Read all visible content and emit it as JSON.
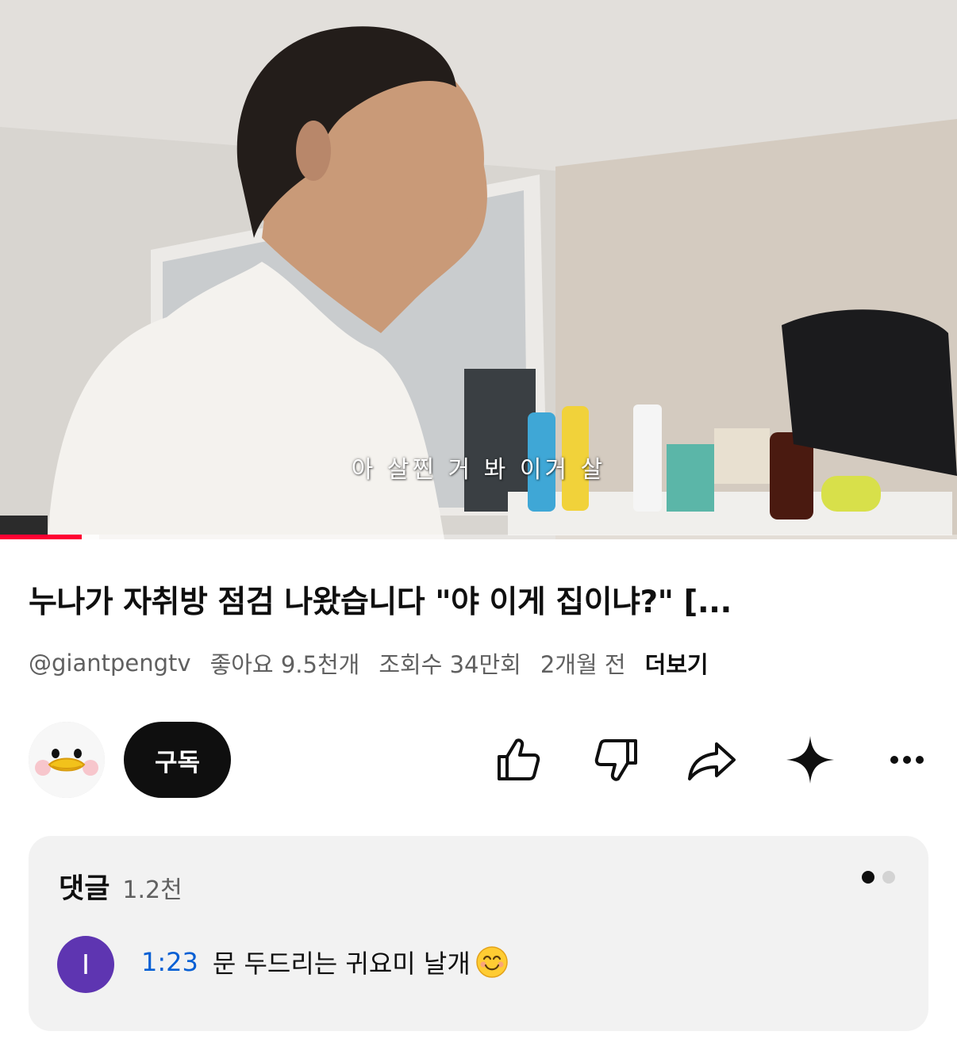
{
  "video": {
    "subtitle": "아 살찐 거 봐 이거 살",
    "progress": 0.085,
    "buffered": 0.104,
    "progress_color": "#ff0033"
  },
  "details": {
    "title": "누나가 자취방 점검 나왔습니다 \"야 이게 집이냐?\" [...",
    "channel_handle": "@giantpengtv",
    "likes": "좋아요 9.5천개",
    "views": "조회수 34만회",
    "age": "2개월 전",
    "more_label": "더보기"
  },
  "actions": {
    "subscribe_label": "구독",
    "icons": [
      "like-icon",
      "dislike-icon",
      "share-icon",
      "sparkle-icon",
      "more-icon"
    ]
  },
  "comments": {
    "label": "댓글",
    "count": "1.2천",
    "top_comment": {
      "avatar_letter": "I",
      "avatar_color": "#5e35b1",
      "timestamp": "1:23",
      "text": "문 두드리는 귀요미 날개",
      "emoji": "smiling-face-icon"
    }
  }
}
